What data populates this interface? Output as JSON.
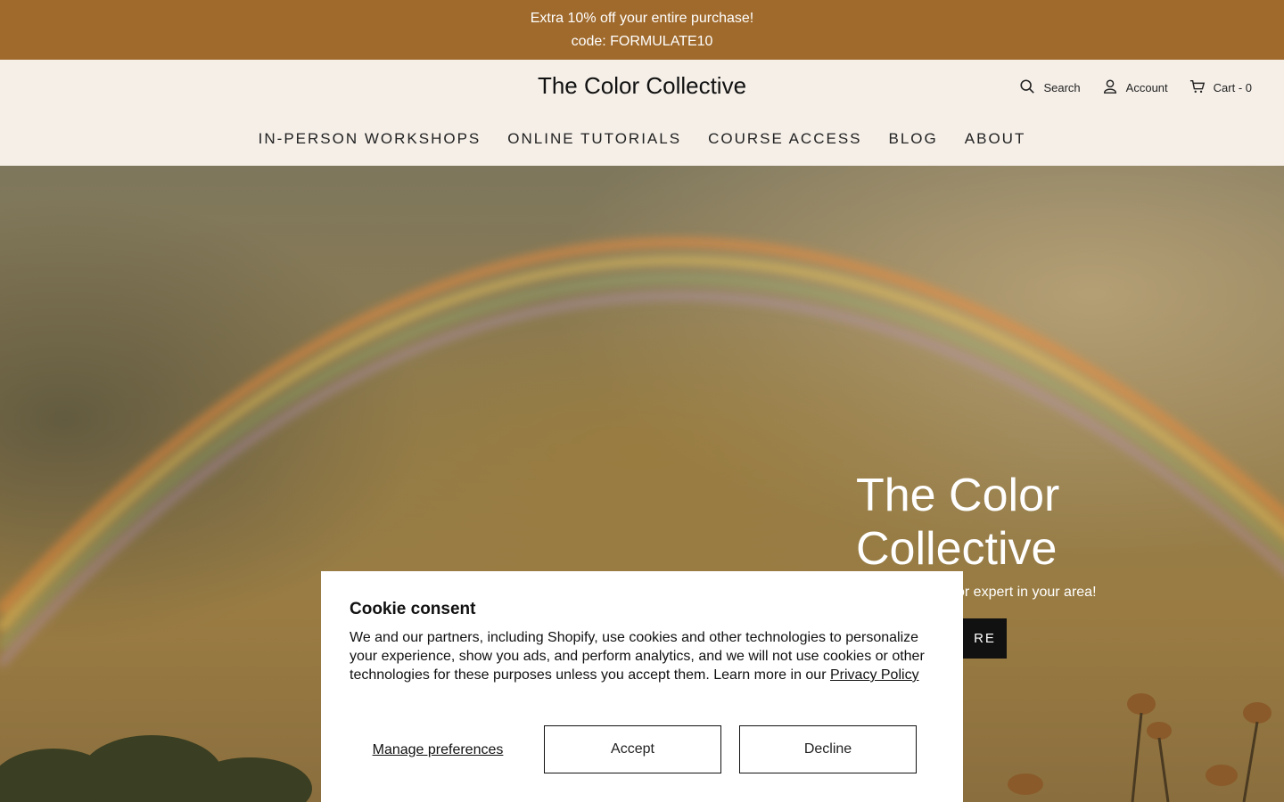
{
  "announcement": {
    "line1": "Extra 10% off your entire purchase!",
    "line2": "code: FORMULATE10"
  },
  "header": {
    "brand": "The Color Collective",
    "search_label": "Search",
    "account_label": "Account",
    "cart_label": "Cart - 0"
  },
  "nav": {
    "items": [
      {
        "label": "IN-PERSON WORKSHOPS"
      },
      {
        "label": "ONLINE TUTORIALS"
      },
      {
        "label": "COURSE ACCESS"
      },
      {
        "label": "BLOG"
      },
      {
        "label": "ABOUT"
      }
    ]
  },
  "hero": {
    "title_line1": "The Color",
    "title_line2": "Collective",
    "subtitle_visible": "or expert in your area!",
    "button_visible": "RE"
  },
  "cookie": {
    "title": "Cookie consent",
    "body": "We and our partners, including Shopify, use cookies and other technologies to personalize your experience, show you ads, and perform analytics, and we will not use cookies or other technologies for these purposes unless you accept them. Learn more in our",
    "privacy_link": "Privacy Policy",
    "manage_label": "Manage preferences",
    "accept_label": "Accept",
    "decline_label": "Decline"
  },
  "colors": {
    "announcement_bg": "#a06a2c",
    "header_bg": "#f5efe8",
    "button_dark": "#111111"
  }
}
